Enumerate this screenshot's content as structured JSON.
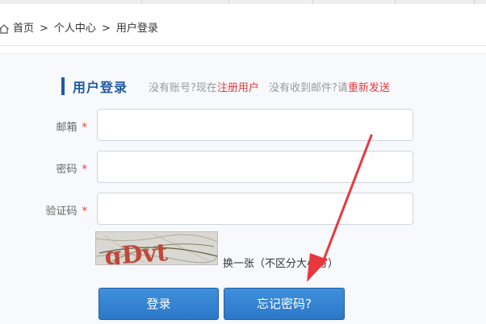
{
  "breadcrumb": {
    "home": "首页",
    "sep1": ">",
    "level2": "个人中心",
    "sep2": ">",
    "current": "用户登录"
  },
  "login": {
    "title": "用户登录",
    "tip_prefix": "没有账号?现在",
    "register_link": "注册用户",
    "tip2_prefix": "没有收到邮件?请",
    "resend_link": "重新发送",
    "email_label": "邮箱",
    "password_label": "密码",
    "captcha_label": "验证码",
    "required_mark": "*",
    "email_value": "",
    "password_value": "",
    "captcha_value": "",
    "captcha_image_text": "gDvt",
    "captcha_refresh": "换一张（不区分大小写）",
    "login_button": "登录",
    "forgot_button": "忘记密码?"
  },
  "colors": {
    "accent": "#1f5aa5",
    "link_red": "#e4393c",
    "button_blue": "#2c78c8",
    "annotation_arrow": "#e8383d"
  },
  "icons": [
    "home-icon"
  ]
}
